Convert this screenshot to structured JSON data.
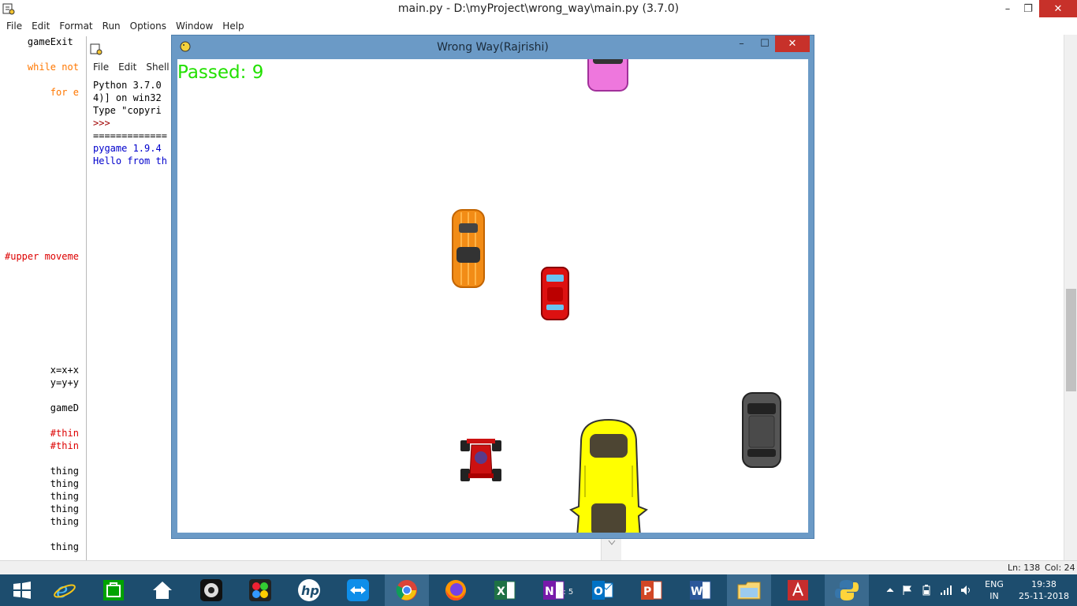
{
  "editor": {
    "title": "main.py - D:\\myProject\\wrong_way\\main.py (3.7.0)",
    "menu": [
      "File",
      "Edit",
      "Format",
      "Run",
      "Options",
      "Window",
      "Help"
    ],
    "code_lines": [
      {
        "text": "    gameExit",
        "color": "#000000"
      },
      {
        "text": "    while not",
        "color": "#ff7700"
      },
      {
        "text": "        for e",
        "color": "#ff7700"
      },
      {
        "text": "#upper moveme",
        "color": "#dd0000"
      },
      {
        "text": "        x=x+x",
        "color": "#000000"
      },
      {
        "text": "        y=y+y",
        "color": "#000000"
      },
      {
        "text": "        gameD",
        "color": "#000000"
      },
      {
        "text": "        #thin",
        "color": "#dd0000"
      },
      {
        "text": "        #thin",
        "color": "#dd0000"
      },
      {
        "text": "        thing",
        "color": "#000000"
      },
      {
        "text": "        thing",
        "color": "#000000"
      },
      {
        "text": "        thing",
        "color": "#000000"
      },
      {
        "text": "        thing",
        "color": "#000000"
      },
      {
        "text": "        thing",
        "color": "#000000"
      },
      {
        "text": "        thing",
        "color": "#000000"
      }
    ],
    "status": {
      "line": "Ln: 138",
      "col": "Col: 24"
    }
  },
  "shell": {
    "menu": [
      "File",
      "Edit",
      "Shell"
    ],
    "lines": [
      {
        "text": "Python 3.7.0 ",
        "color": "#000000"
      },
      {
        "text": "4)] on win32",
        "color": "#000000"
      },
      {
        "text": "Type \"copyri",
        "color": "#000000"
      },
      {
        "text": ">>> ",
        "color": "#a00000"
      },
      {
        "text": "=============",
        "color": "#000000"
      },
      {
        "text": "pygame 1.9.4",
        "color": "#0000cc"
      },
      {
        "text": "Hello from th",
        "color": "#0000cc"
      }
    ]
  },
  "game": {
    "title": "Wrong Way(Rajrishi)",
    "score_text": "Passed: 9",
    "score_color": "#22e000",
    "cars": [
      {
        "name": "pink-car",
        "color": "#ee77dd"
      },
      {
        "name": "orange-car",
        "color": "#f28c16"
      },
      {
        "name": "red-car",
        "color": "#dd1111"
      },
      {
        "name": "gray-car",
        "color": "#555555"
      },
      {
        "name": "yellow-car",
        "color": "#ffff00"
      },
      {
        "name": "player-race-car",
        "color": "#cc1111"
      }
    ]
  },
  "taskbar": {
    "color": "#1d4d6e",
    "onenote_partial": "n: 5",
    "lang_top": "ENG",
    "lang_bottom": "IN",
    "time": "19:38",
    "date": "25-11-2018",
    "apps": [
      "windows-start",
      "internet-explorer",
      "store",
      "home",
      "webcam",
      "paint",
      "hp",
      "teamviewer",
      "chrome",
      "firefox",
      "excel",
      "onenote",
      "outlook",
      "powerpoint",
      "word",
      "file-explorer",
      "acrobat",
      "python"
    ]
  }
}
